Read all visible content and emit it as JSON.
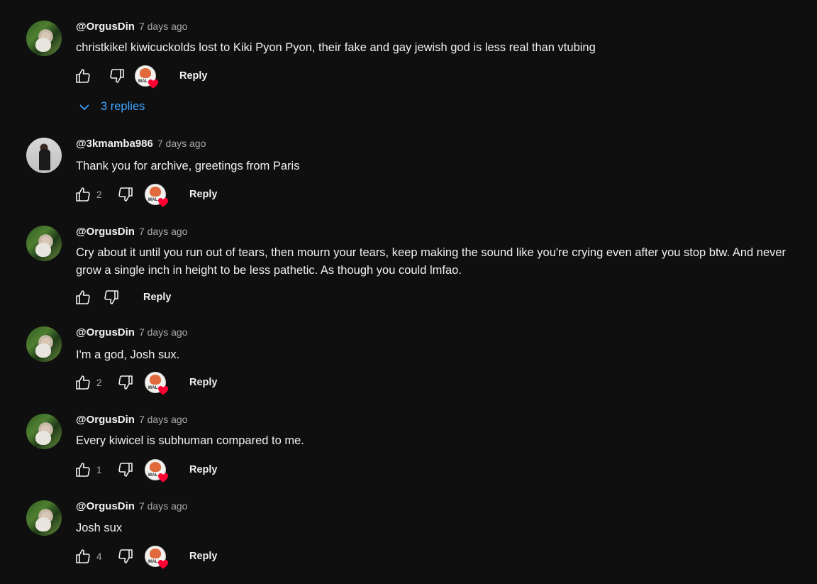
{
  "comments": [
    {
      "author": "@OrgusDin",
      "time": "7 days ago",
      "text": "christkikel kiwicuckolds lost to Kiki Pyon Pyon, their fake and gay jewish god is less real than vtubing",
      "likes": "",
      "hearted": true,
      "reply_label": "Reply",
      "replies_label": "3 replies"
    },
    {
      "author": "@3kmamba986",
      "time": "7 days ago",
      "text": "Thank you for archive, greetings from Paris",
      "likes": "2",
      "hearted": true,
      "reply_label": "Reply"
    },
    {
      "author": "@OrgusDin",
      "time": "7 days ago",
      "text": "Cry about it until you run out of tears, then mourn your tears, keep making the sound like you're crying even after you stop btw. And never grow a single inch in height to be less pathetic. As though you could lmfao.",
      "likes": "",
      "hearted": false,
      "reply_label": "Reply"
    },
    {
      "author": "@OrgusDin",
      "time": "7 days ago",
      "text": "I'm a god, Josh sux.",
      "likes": "2",
      "hearted": true,
      "reply_label": "Reply"
    },
    {
      "author": "@OrgusDin",
      "time": "7 days ago",
      "text": "Every kiwicel is subhuman compared to me.",
      "likes": "1",
      "hearted": true,
      "reply_label": "Reply"
    },
    {
      "author": "@OrgusDin",
      "time": "7 days ago",
      "text": "Josh sux",
      "likes": "4",
      "hearted": true,
      "reply_label": "Reply"
    }
  ],
  "icons": {
    "like": "thumbs-up-icon",
    "dislike": "thumbs-down-icon",
    "heart": "heart-icon",
    "expand": "chevron-down-icon"
  },
  "colors": {
    "background": "#0f0f0f",
    "link_blue": "#3ea6ff",
    "heart_red": "#ff0033",
    "muted": "#aaaaaa"
  }
}
